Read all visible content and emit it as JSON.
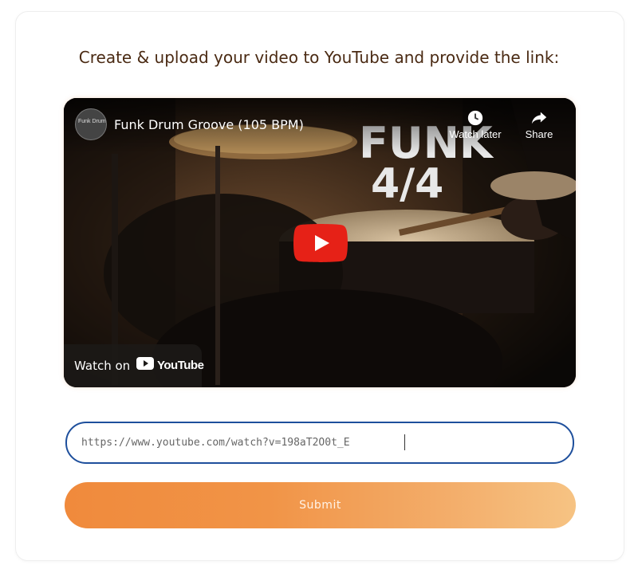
{
  "page": {
    "heading": "Create & upload your video to YouTube and provide the link:"
  },
  "video": {
    "title": "Funk Drum Groove (105 BPM)",
    "channel_avatar_text": "Funk Drum",
    "overlay_text_line1": "FUNK",
    "overlay_text_line2": "4/4",
    "watch_later_label": "Watch later",
    "share_label": "Share",
    "watch_on_label": "Watch on",
    "youtube_wordmark": "YouTube",
    "play_button_color": "#e62117"
  },
  "form": {
    "url_value": "https://www.youtube.com/watch?v=198aT2O0t_E",
    "submit_label": "Submit",
    "input_border_color": "#1e4f9c",
    "submit_gradient_start": "#f08a3c",
    "submit_gradient_end": "#f6c383"
  }
}
